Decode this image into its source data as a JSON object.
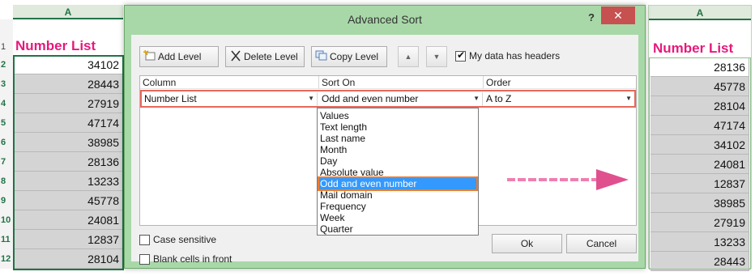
{
  "left_sheet": {
    "column_letter": "A",
    "header": "Number List",
    "row_numbers": [
      "1",
      "2",
      "3",
      "4",
      "5",
      "6",
      "7",
      "8",
      "9",
      "10",
      "11",
      "12"
    ],
    "values": [
      "34102",
      "28443",
      "27919",
      "47174",
      "38985",
      "28136",
      "13233",
      "45778",
      "24081",
      "12837",
      "28104"
    ]
  },
  "right_sheet": {
    "column_letter": "A",
    "header": "Number List",
    "values": [
      "28136",
      "45778",
      "28104",
      "47174",
      "34102",
      "24081",
      "12837",
      "38985",
      "27919",
      "13233",
      "28443"
    ]
  },
  "dialog": {
    "title": "Advanced Sort",
    "help_label": "?",
    "close_label": "✕",
    "toolbar": {
      "add_level": "Add Level",
      "delete_level": "Delete Level",
      "copy_level": "Copy Level",
      "move_up": "▲",
      "move_down": "▼",
      "headers_checkbox_label": "My data has headers",
      "headers_checked": true
    },
    "grid": {
      "headers": [
        "Column",
        "Sort On",
        "Order"
      ],
      "row": {
        "column": "Number List",
        "sort_on": "Odd and even number",
        "order": "A to Z"
      }
    },
    "sort_on_options": [
      "Values",
      "Text length",
      "Last name",
      "Month",
      "Day",
      "Absolute value",
      "Odd and even number",
      "Mail domain",
      "Frequency",
      "Week",
      "Quarter"
    ],
    "selected_option": "Odd and even number",
    "case_sensitive_label": "Case sensitive",
    "blank_cells_label": "Blank cells in front",
    "ok_label": "Ok",
    "cancel_label": "Cancel"
  },
  "colors": {
    "accent_pink": "#e6197c",
    "excel_green": "#217346",
    "dialog_frame": "#a8d8a8",
    "highlight_orange": "#ef7b2e",
    "selection_blue": "#3399ff"
  }
}
